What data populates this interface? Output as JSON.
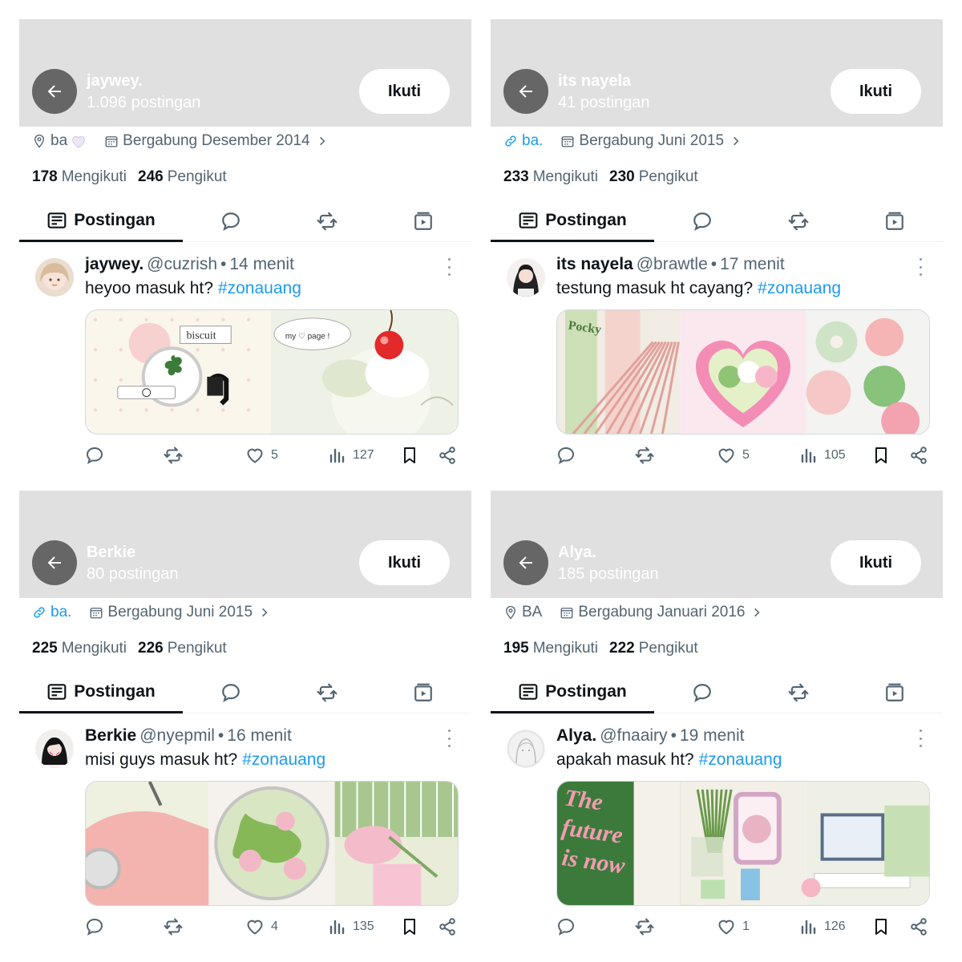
{
  "colors": {
    "header_bg": "#e0e0e0",
    "accent": "#1d9bf0",
    "muted": "#536471",
    "text": "#0f1419"
  },
  "icons": {
    "back": "arrow-left-icon",
    "location": "map-pin-icon",
    "link": "link-icon",
    "calendar": "calendar-icon",
    "posts_tab": "newspaper-icon",
    "replies_tab": "speech-bubble-icon",
    "retweets_tab": "retweet-icon",
    "media_tab": "media-play-icon",
    "reply": "reply-icon",
    "retweet": "retweet-icon",
    "like": "heart-icon",
    "views": "bar-chart-icon",
    "bookmark": "bookmark-icon",
    "share": "share-icon",
    "more": "more-vertical-icon"
  },
  "panels": [
    {
      "header": {
        "name": "jaywey.",
        "post_count": "1.096 postingan",
        "follow_label": "Ikuti"
      },
      "meta": {
        "location": "ba",
        "location_type": "location",
        "location_heart": true,
        "joined": "Bergabung Desember 2014"
      },
      "stats": {
        "following": "178",
        "following_label": "Mengikuti",
        "followers": "246",
        "followers_label": "Pengikut"
      },
      "tabs": {
        "posts": "Postingan"
      },
      "post": {
        "name": "jaywey.",
        "handle": "@cuzrish",
        "sep": "•",
        "time": "14 menit",
        "text": "heyoo masuk ht?",
        "hashtag": "#zonauang",
        "stats": {
          "likes": "5",
          "views": "127"
        }
      }
    },
    {
      "header": {
        "name": "its nayela",
        "post_count": "41 postingan",
        "follow_label": "Ikuti"
      },
      "meta": {
        "location": "ba.",
        "location_type": "link",
        "location_heart": false,
        "joined": "Bergabung Juni 2015"
      },
      "stats": {
        "following": "233",
        "following_label": "Mengikuti",
        "followers": "230",
        "followers_label": "Pengikut"
      },
      "tabs": {
        "posts": "Postingan"
      },
      "post": {
        "name": "its nayela",
        "handle": "@brawtle",
        "sep": "•",
        "time": "17 menit",
        "text": "testung masuk ht cayang?",
        "hashtag": "#zonauang",
        "stats": {
          "likes": "5",
          "views": "105"
        }
      }
    },
    {
      "header": {
        "name": "Berkie",
        "post_count": "80 postingan",
        "follow_label": "Ikuti"
      },
      "meta": {
        "location": "ba.",
        "location_type": "link",
        "location_heart": false,
        "joined": "Bergabung Juni 2015"
      },
      "stats": {
        "following": "225",
        "following_label": "Mengikuti",
        "followers": "226",
        "followers_label": "Pengikut"
      },
      "tabs": {
        "posts": "Postingan"
      },
      "post": {
        "name": "Berkie",
        "handle": "@nyepmil",
        "sep": "•",
        "time": "16 menit",
        "text": "misi guys masuk ht?",
        "hashtag": "#zonauang",
        "stats": {
          "likes": "4",
          "views": "135"
        }
      }
    },
    {
      "header": {
        "name": "Alya.",
        "post_count": "185 postingan",
        "follow_label": "Ikuti"
      },
      "meta": {
        "location": "BA",
        "location_type": "location",
        "location_heart": false,
        "joined": "Bergabung Januari 2016"
      },
      "stats": {
        "following": "195",
        "following_label": "Mengikuti",
        "followers": "222",
        "followers_label": "Pengikut"
      },
      "tabs": {
        "posts": "Postingan"
      },
      "post": {
        "name": "Alya.",
        "handle": "@fnaairy",
        "sep": "•",
        "time": "19 menit",
        "text": "apakah masuk ht?",
        "hashtag": "#zonauang",
        "stats": {
          "likes": "1",
          "views": "126"
        }
      }
    }
  ],
  "media": {
    "p0_words": [
      "biscuit",
      "my ♡ page !"
    ],
    "p1_words": [
      "Pocky"
    ],
    "p3_words": [
      "The future is now"
    ]
  }
}
